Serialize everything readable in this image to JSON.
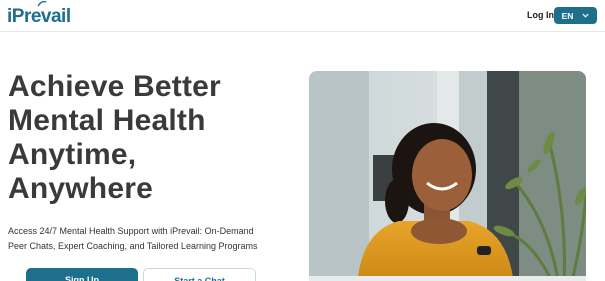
{
  "header": {
    "logo_text": "iPrevail",
    "login_label": "Log In",
    "language": "EN"
  },
  "hero": {
    "title_lines": [
      "Achieve Better",
      "Mental Health",
      "Anytime,",
      "Anywhere"
    ],
    "subtitle_lines": [
      "Access 24/7 Mental Health Support with iPrevail: On-Demand",
      "Peer Chats, Expert Coaching, and Tailored Learning Programs"
    ],
    "primary_button": "Sign Up",
    "secondary_button": "Start a Chat"
  },
  "colors": {
    "brand": "#1d6f8c",
    "heading": "#3a3a3a",
    "shirt": "#e39a1c"
  },
  "icons": {
    "language_dropdown": "chevron-down-icon"
  }
}
